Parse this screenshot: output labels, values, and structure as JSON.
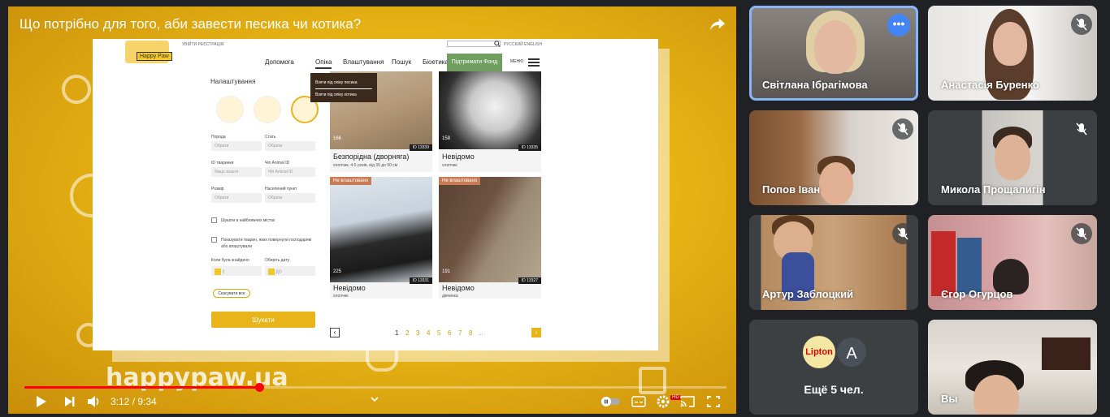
{
  "video": {
    "title": "Що потрібно для того, аби завести песика чи котика?",
    "current_time": "3:12",
    "separator": " / ",
    "duration": "9:34",
    "progress_fraction": 0.335,
    "hd_badge": "HD",
    "watermark": "happypaw.ua"
  },
  "website": {
    "logo_text": "Happy Paw",
    "top_links": "УВІЙТИ   РЕЄСТРАЦІЯ",
    "languages": "РУССКИЙ   ENGLISH",
    "nav": [
      "Допомога",
      "Опіка",
      "Влаштування",
      "Пошук",
      "Біоетика"
    ],
    "support_fund": "Підтримати Фонд",
    "menu_label": "МЕНЮ",
    "dropdown": [
      "Взяти під опіку песика",
      "Взяти під опіку котика"
    ],
    "filters": {
      "title": "Налаштування",
      "breed_label": "Порода",
      "breed_value": "Обрати",
      "sex_label": "Стать",
      "sex_value": "Обрати",
      "animal_id_label": "ID тваринки",
      "animal_id_placeholder": "Якщо знаєте",
      "chip_label": "Чіп Animal ID",
      "chip_placeholder": "Чіп Animal ID",
      "size_label": "Розмір",
      "size_value": "Обрати",
      "city_label": "Населений пункт",
      "city_value": "Обрати",
      "nearby_checkbox": "Шукати в найближчих містах",
      "returned_checkbox": "Показувати тварин, яких повернули господарям або влаштували",
      "found_label": "Коли була знайдено",
      "date_label": "Оберіть дату",
      "date_from": "З",
      "date_to": "ДО",
      "reset_button": "Скасувати все",
      "search_button": "Шукати"
    },
    "cards": [
      {
        "badge": "",
        "views": "166",
        "id": "ID 13339",
        "name": "Безпорідна (дворняга)",
        "sub": "хлопчик, 4-5 років, від 35 до 50 см"
      },
      {
        "badge": "",
        "views": "158",
        "id": "ID 13335",
        "name": "Невідомо",
        "sub": "хлопчик"
      },
      {
        "badge": "Не влаштовано",
        "views": "225",
        "id": "ID 13331",
        "name": "Невідомо",
        "sub": "хлопчик"
      },
      {
        "badge": "Не влаштовано",
        "views": "191",
        "id": "ID 13327",
        "name": "Невідомо",
        "sub": "дівчинка"
      }
    ],
    "pagination": [
      "1",
      "2",
      "3",
      "4",
      "5",
      "6",
      "7",
      "8",
      "..."
    ]
  },
  "participants": [
    {
      "name": "Світлана Ібрагімова",
      "active": true
    },
    {
      "name": "Анастасія Буренко"
    },
    {
      "name": "Попов Іван"
    },
    {
      "name": "Микола Прощалигін"
    },
    {
      "name": "Артур Заблоцкий"
    },
    {
      "name": "Єгор Огурцов"
    },
    {
      "name": "Ещё 5 чел."
    },
    {
      "name": "Вы"
    }
  ],
  "more_avatars": [
    "Lipton",
    "A"
  ],
  "colors": {
    "meet_bg": "#202124",
    "tile_bg": "#3c4043",
    "active_border": "#8ab4f8",
    "progress": "#ff0000",
    "site_yellow": "#e9b41a",
    "fund_green": "#6f9e5f"
  },
  "icons": [
    "share-icon",
    "play-icon",
    "next-icon",
    "volume-icon",
    "chevron-down-icon",
    "autoplay-toggle",
    "subtitles-icon",
    "settings-icon",
    "cast-icon",
    "fullscreen-icon",
    "mic-off-icon",
    "more-options-icon"
  ]
}
